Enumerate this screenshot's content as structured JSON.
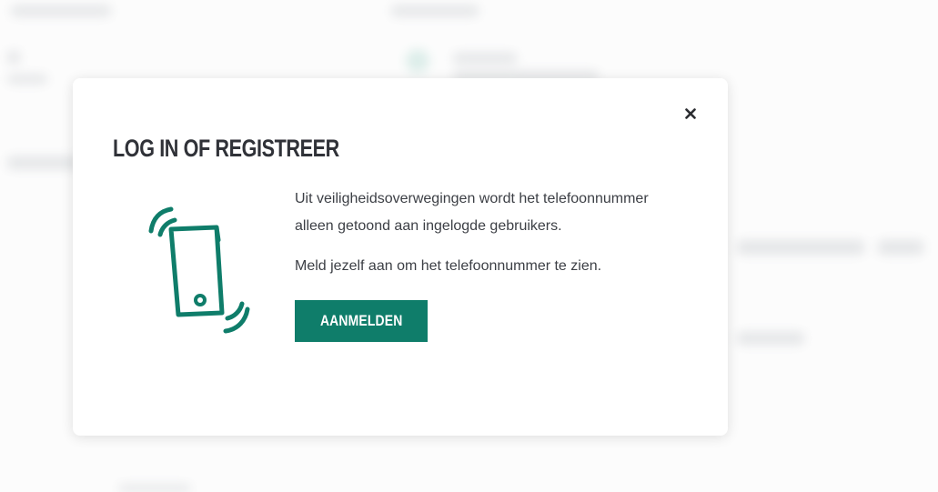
{
  "modal": {
    "title": "LOG IN OF REGISTREER",
    "message_1": "Uit veiligheidsoverwegingen wordt het telefoonnummer alleen getoond aan ingelogde gebruikers.",
    "message_2": "Meld jezelf aan om het telefoonnummer te zien.",
    "button_label": "AANMELDEN",
    "close_icon": "close-icon",
    "illustration_icon": "phone-ringing-icon"
  },
  "colors": {
    "accent": "#0f7d6a",
    "title": "#303238",
    "text": "#3c3f45"
  }
}
